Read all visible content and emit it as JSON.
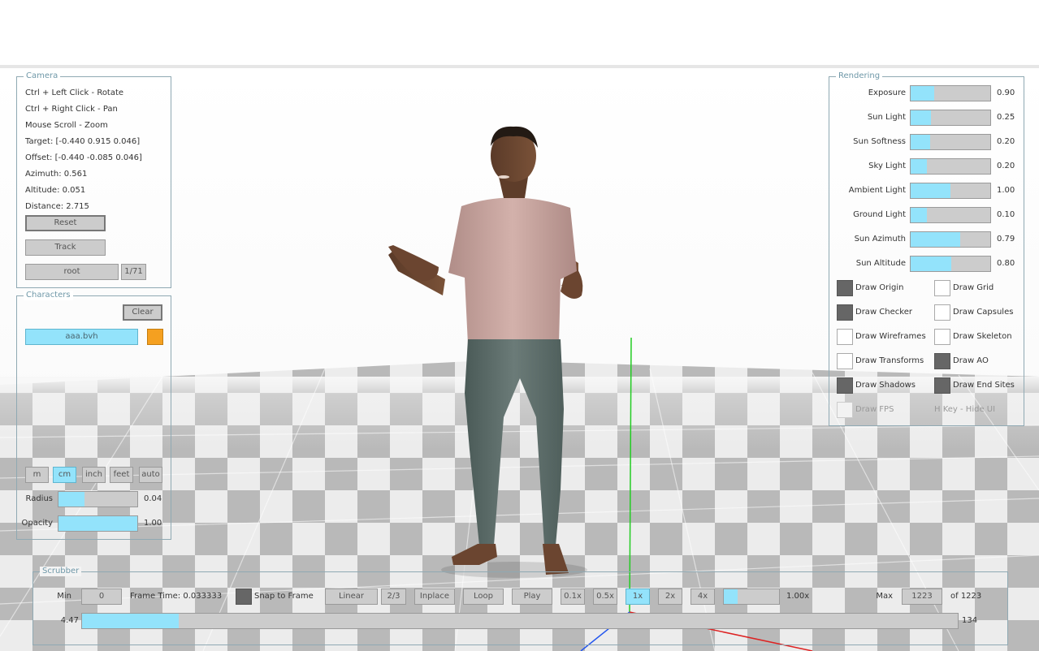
{
  "camera": {
    "title": "Camera",
    "lines": [
      "Ctrl + Left Click - Rotate",
      "Ctrl + Right Click - Pan",
      "Mouse Scroll - Zoom",
      "Target: [-0.440  0.915  0.046]",
      "Offset: [-0.440 -0.085  0.046]",
      "Azimuth: 0.561",
      "Altitude: 0.051",
      "Distance: 2.715"
    ],
    "reset_label": "Reset",
    "track_label": "Track",
    "bone_value": "root",
    "bone_counter": "1/71"
  },
  "characters": {
    "title": "Characters",
    "clear_label": "Clear",
    "items": [
      {
        "name": "aaa.bvh",
        "color": "#f5a020"
      }
    ],
    "units": [
      "m",
      "cm",
      "inch",
      "feet",
      "auto"
    ],
    "active_unit": "cm",
    "radius_label": "Radius",
    "radius_value": "0.04",
    "radius_fraction": 0.33,
    "opacity_label": "Opacity",
    "opacity_value": "1.00",
    "opacity_fraction": 1.0
  },
  "rendering": {
    "title": "Rendering",
    "sliders": [
      {
        "label": "Exposure",
        "value": "0.90",
        "fraction": 0.3
      },
      {
        "label": "Sun Light",
        "value": "0.25",
        "fraction": 0.25
      },
      {
        "label": "Sun Softness",
        "value": "0.20",
        "fraction": 0.24
      },
      {
        "label": "Sky Light",
        "value": "0.20",
        "fraction": 0.2
      },
      {
        "label": "Ambient Light",
        "value": "1.00",
        "fraction": 0.5
      },
      {
        "label": "Ground Light",
        "value": "0.10",
        "fraction": 0.2
      },
      {
        "label": "Sun Azimuth",
        "value": "0.79",
        "fraction": 0.62
      },
      {
        "label": "Sun Altitude",
        "value": "0.80",
        "fraction": 0.51
      }
    ],
    "toggles": [
      {
        "label": "Draw Origin",
        "checked": true
      },
      {
        "label": "Draw Grid",
        "checked": false
      },
      {
        "label": "Draw Checker",
        "checked": true
      },
      {
        "label": "Draw Capsules",
        "checked": false
      },
      {
        "label": "Draw Wireframes",
        "checked": false
      },
      {
        "label": "Draw Skeleton",
        "checked": false
      },
      {
        "label": "Draw Transforms",
        "checked": false
      },
      {
        "label": "Draw AO",
        "checked": true
      },
      {
        "label": "Draw Shadows",
        "checked": true
      },
      {
        "label": "Draw End Sites",
        "checked": true
      },
      {
        "label": "Draw FPS",
        "checked": false
      }
    ],
    "hint": "H Key - Hide UI"
  },
  "scrubber": {
    "title": "Scrubber",
    "min_label": "Min",
    "min_value": "0",
    "frame_time": "Frame Time: 0.033333",
    "snap_label": "Snap to Frame",
    "snap_checked": true,
    "interp_value": "Linear",
    "interp_counter": "2/3",
    "inplace_label": "Inplace",
    "loop_label": "Loop",
    "play_label": "Play",
    "speeds": [
      "0.1x",
      "0.5x",
      "1x",
      "2x",
      "4x"
    ],
    "active_speed": "1x",
    "speed_value": "1.00x",
    "speed_fraction": 0.1,
    "max_label": "Max",
    "max_value": "1223",
    "of_total": "of 1223",
    "time_value": "4.47",
    "frame_value": "134",
    "progress_fraction": 0.11
  },
  "colors": {
    "accent": "#93e3fb",
    "panel_border": "#8fa9b3",
    "panel_title": "#6f98a8",
    "control_bg": "#cccccc",
    "character_swatch": "#f5a020"
  }
}
